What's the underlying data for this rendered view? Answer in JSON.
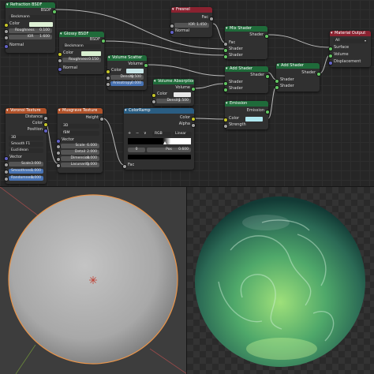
{
  "colors": {
    "accent_blue": "#4772b3",
    "shader_header": "#1f6b3a",
    "input_header": "#8a2230",
    "texture_header": "#b0522a",
    "converter_header": "#2a5d82",
    "outline_orange": "#e8944a"
  },
  "nodes": {
    "refraction": {
      "title": "Refraction BSDF",
      "output": "BSDF",
      "distribution": "Beckmann",
      "color_label": "Color",
      "roughness_label": "Roughness",
      "roughness_value": "0.100",
      "ior_label": "IOR",
      "ior_value": "1.600",
      "normal_label": "Normal",
      "color_swatch": "#dff2d6"
    },
    "glossy": {
      "title": "Glossy BSDF",
      "output": "BSDF",
      "distribution": "Beckmann",
      "color_label": "Color",
      "roughness_label": "Roughness",
      "roughness_value": "0.150",
      "normal_label": "Normal",
      "color_swatch": "#d8f0d0"
    },
    "fresnel": {
      "title": "Fresnel",
      "output": "Fac",
      "ior_label": "IOR",
      "ior_value": "1.450",
      "normal_label": "Normal"
    },
    "mix_shader": {
      "title": "Mix Shader",
      "output": "Shader",
      "fac_label": "Fac",
      "in1": "Shader",
      "in2": "Shader"
    },
    "volume_scatter": {
      "title": "Volume Scatter",
      "output": "Volume",
      "color_label": "Color",
      "density_label": "Density",
      "density_value": "0.500",
      "anisotropy_label": "Anisotropy",
      "anisotropy_value": "0.000",
      "color_swatch": "#c8e6e8"
    },
    "volume_absorption": {
      "title": "Volume Absorption",
      "output": "Volume",
      "color_label": "Color",
      "density_label": "Density",
      "density_value": "1.500",
      "color_swatch": "#e8e8e8"
    },
    "add_shader1": {
      "title": "Add Shader",
      "output": "Shader",
      "in1": "Shader",
      "in2": "Shader"
    },
    "add_shader2": {
      "title": "Add Shader",
      "output": "Shader",
      "in1": "Shader",
      "in2": "Shader"
    },
    "material_output": {
      "title": "Material Output",
      "target": "All",
      "surface": "Surface",
      "volume": "Volume",
      "displacement": "Displacement"
    },
    "voronoi": {
      "title": "Voronoi Texture",
      "out1": "Distance",
      "out2": "Color",
      "out3": "Position",
      "dim": "3D",
      "feature": "Smooth F1",
      "metric": "Euclidean",
      "vector_label": "Vector",
      "scale_label": "Scale",
      "scale_value": "3.000",
      "smooth_label": "Smoothness",
      "smooth_value": "1.000",
      "random_label": "Randomness",
      "random_value": "1.000"
    },
    "musgrave": {
      "title": "Musgrave Texture",
      "output": "Height",
      "dim": "3D",
      "type": "fBM",
      "vector_label": "Vector",
      "scale_label": "Scale",
      "scale_value": "6.000",
      "detail_label": "Detail",
      "detail_value": "2.000",
      "dimension_label": "Dimension",
      "dimension_value": "0.000",
      "lacunarity_label": "Lacunarity",
      "lacunarity_value": "1.000"
    },
    "colorramp": {
      "title": "ColorRamp",
      "out1": "Color",
      "out2": "Alpha",
      "add": "+",
      "remove": "−",
      "dropdown": "∨",
      "mode": "RGB",
      "interp": "Linear",
      "index": "0",
      "pos_label": "Pos",
      "pos_value": "0.600",
      "fac_label": "Fac"
    },
    "emission": {
      "title": "Emission",
      "output": "Emission",
      "color_label": "Color",
      "strength_label": "Strength",
      "color_swatch": "#b0e8f0"
    }
  }
}
